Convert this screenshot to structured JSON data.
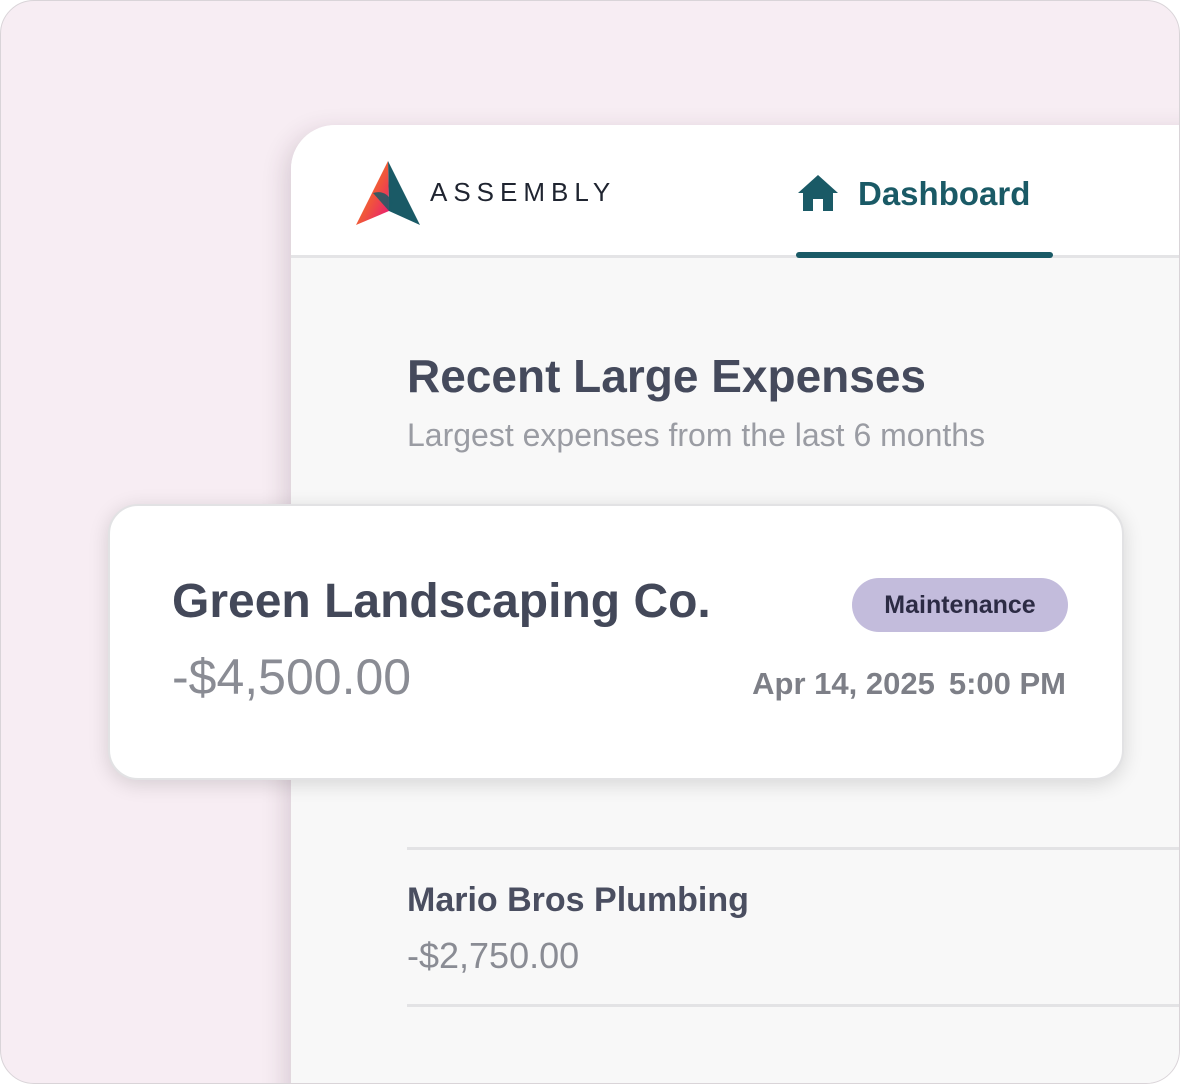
{
  "app": {
    "brand_name": "ASSEMBLY",
    "logo_icon": "assembly-logo-icon"
  },
  "nav": {
    "active_tab": {
      "label": "Dashboard",
      "icon": "home-icon"
    }
  },
  "section": {
    "title": "Recent Large Expenses",
    "subtitle": "Largest expenses from the last 6 months"
  },
  "featured_expense": {
    "vendor": "Green Landscaping Co.",
    "amount": "-$4,500.00",
    "category": "Maintenance",
    "date": "Apr 14, 2025",
    "time": "5:00 PM"
  },
  "expenses": [
    {
      "vendor": "Mario Bros Plumbing",
      "amount": "-$2,750.00"
    }
  ],
  "colors": {
    "background": "#f7edf3",
    "accent": "#1a5a66",
    "badge": "#c3bcdc",
    "title_text": "#454a5c",
    "muted_text": "#8a8c94"
  }
}
